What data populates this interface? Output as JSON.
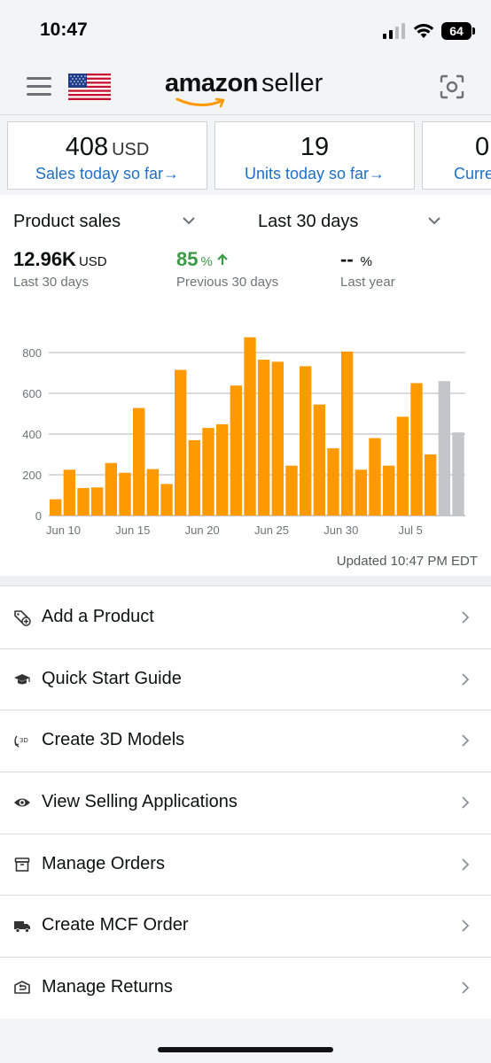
{
  "status_bar": {
    "time": "10:47",
    "battery": "64"
  },
  "header": {
    "logo_brand": "amazon",
    "logo_suffix": "seller"
  },
  "kpis": [
    {
      "value": "408",
      "unit": "USD",
      "link": "Sales today so far→"
    },
    {
      "value": "19",
      "unit": "",
      "link": "Units today so far→"
    },
    {
      "value": "0",
      "unit": "",
      "link": "Curre"
    }
  ],
  "sales": {
    "metric_selector": "Product sales",
    "period_selector": "Last 30 days",
    "total": {
      "value": "12.96K",
      "unit": "USD",
      "label": "Last 30 days"
    },
    "previous": {
      "value": "85",
      "unit": "%",
      "label": "Previous 30 days"
    },
    "last_year": {
      "value": "--",
      "unit": "%",
      "label": "Last year"
    },
    "updated": "Updated 10:47 PM EDT"
  },
  "chart_data": {
    "type": "bar",
    "categories": [
      "Jun 9",
      "Jun 10",
      "Jun 11",
      "Jun 12",
      "Jun 13",
      "Jun 14",
      "Jun 15",
      "Jun 16",
      "Jun 17",
      "Jun 18",
      "Jun 19",
      "Jun 20",
      "Jun 21",
      "Jun 22",
      "Jun 23",
      "Jun 24",
      "Jun 25",
      "Jun 26",
      "Jun 27",
      "Jun 28",
      "Jun 29",
      "Jun 30",
      "Jul 1",
      "Jul 2",
      "Jul 3",
      "Jul 4",
      "Jul 5",
      "Jul 6",
      "Jul 7",
      "Jul 8"
    ],
    "values": [
      80,
      225,
      135,
      138,
      258,
      210,
      528,
      228,
      155,
      715,
      370,
      430,
      448,
      638,
      875,
      765,
      755,
      245,
      733,
      545,
      330,
      805,
      225,
      380,
      245,
      485,
      650,
      300,
      660,
      408
    ],
    "series_colors": [
      "#ff9900",
      "#ff9900",
      "#ff9900",
      "#ff9900",
      "#ff9900",
      "#ff9900",
      "#ff9900",
      "#ff9900",
      "#ff9900",
      "#ff9900",
      "#ff9900",
      "#ff9900",
      "#ff9900",
      "#ff9900",
      "#ff9900",
      "#ff9900",
      "#ff9900",
      "#ff9900",
      "#ff9900",
      "#ff9900",
      "#ff9900",
      "#ff9900",
      "#ff9900",
      "#ff9900",
      "#ff9900",
      "#ff9900",
      "#ff9900",
      "#ff9900",
      "#c4c5c9",
      "#c4c5c9"
    ],
    "x_tick_labels": [
      {
        "label": "Jun 10",
        "index": 1
      },
      {
        "label": "Jun 15",
        "index": 6
      },
      {
        "label": "Jun 20",
        "index": 11
      },
      {
        "label": "Jun 25",
        "index": 16
      },
      {
        "label": "Jun 30",
        "index": 21
      },
      {
        "label": "Jul 5",
        "index": 26
      }
    ],
    "y_ticks": [
      0,
      200,
      400,
      600,
      800
    ],
    "ylim": [
      0,
      900
    ],
    "grid": true,
    "title": "",
    "xlabel": "",
    "ylabel": ""
  },
  "menu": [
    {
      "label": "Add a Product",
      "icon": "tag-plus-icon"
    },
    {
      "label": "Quick Start Guide",
      "icon": "graduation-cap-icon"
    },
    {
      "label": "Create 3D Models",
      "icon": "3d-rotate-icon"
    },
    {
      "label": "View Selling Applications",
      "icon": "eye-icon"
    },
    {
      "label": "Manage Orders",
      "icon": "box-icon"
    },
    {
      "label": "Create MCF Order",
      "icon": "truck-icon"
    },
    {
      "label": "Manage Returns",
      "icon": "return-box-icon"
    }
  ],
  "colors": {
    "accent": "#ff9900",
    "link": "#1e6fc7",
    "positive": "#3a9b44",
    "projected": "#c4c5c9"
  }
}
